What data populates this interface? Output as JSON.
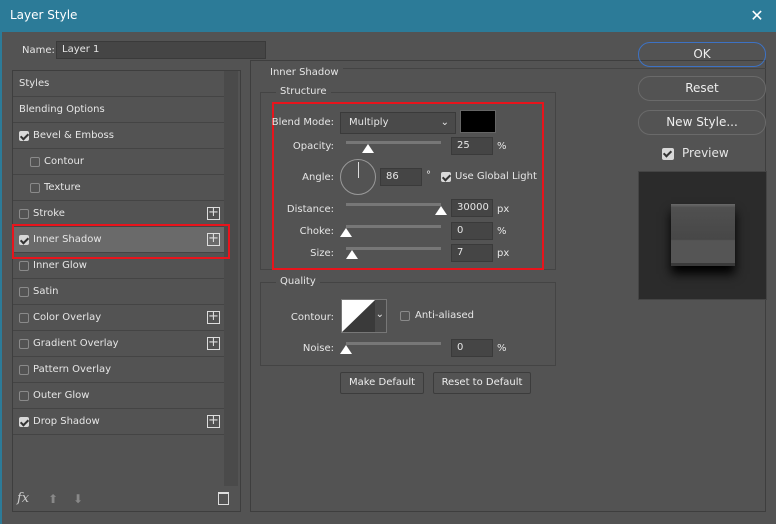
{
  "window": {
    "title": "Layer Style",
    "close_icon": "close-icon"
  },
  "name_field": {
    "label": "Name:",
    "value": "Layer 1"
  },
  "styles_list": [
    {
      "label": "Styles",
      "checkbox": null,
      "plus": false
    },
    {
      "label": "Blending Options",
      "checkbox": null,
      "plus": false
    },
    {
      "label": "Bevel & Emboss",
      "checkbox": true,
      "plus": false
    },
    {
      "label": "Contour",
      "checkbox": false,
      "plus": false,
      "indent": true
    },
    {
      "label": "Texture",
      "checkbox": false,
      "plus": false,
      "indent": true
    },
    {
      "label": "Stroke",
      "checkbox": false,
      "plus": true
    },
    {
      "label": "Inner Shadow",
      "checkbox": true,
      "plus": true,
      "selected": true
    },
    {
      "label": "Inner Glow",
      "checkbox": false,
      "plus": false
    },
    {
      "label": "Satin",
      "checkbox": false,
      "plus": false
    },
    {
      "label": "Color Overlay",
      "checkbox": false,
      "plus": true
    },
    {
      "label": "Gradient Overlay",
      "checkbox": false,
      "plus": true
    },
    {
      "label": "Pattern Overlay",
      "checkbox": false,
      "plus": false
    },
    {
      "label": "Outer Glow",
      "checkbox": false,
      "plus": false
    },
    {
      "label": "Drop Shadow",
      "checkbox": true,
      "plus": true
    }
  ],
  "list_toolbar": {
    "fx": "fx",
    "up_icon": "arrow-up-icon",
    "down_icon": "arrow-down-icon",
    "trash_icon": "trash-icon"
  },
  "panel": {
    "title": "Inner Shadow",
    "structure": {
      "title": "Structure",
      "blend_mode": {
        "label": "Blend Mode:",
        "value": "Multiply",
        "color": "#000000"
      },
      "opacity": {
        "label": "Opacity:",
        "value": "25",
        "unit": "%"
      },
      "angle": {
        "label": "Angle:",
        "value": "86",
        "unit": "°",
        "global_light_label": "Use Global Light",
        "global_light": true
      },
      "distance": {
        "label": "Distance:",
        "value": "30000",
        "unit": "px"
      },
      "choke": {
        "label": "Choke:",
        "value": "0",
        "unit": "%"
      },
      "size": {
        "label": "Size:",
        "value": "7",
        "unit": "px"
      }
    },
    "quality": {
      "title": "Quality",
      "contour_label": "Contour:",
      "anti_aliased_label": "Anti-aliased",
      "anti_aliased": false,
      "noise": {
        "label": "Noise:",
        "value": "0",
        "unit": "%"
      }
    },
    "make_default": "Make Default",
    "reset_default": "Reset to Default"
  },
  "right": {
    "ok": "OK",
    "reset": "Reset",
    "new_style": "New Style...",
    "preview_label": "Preview",
    "preview": true
  },
  "colors": {
    "titlebar": "#2c7b98",
    "highlight": "#e8141c",
    "background": "#535353"
  }
}
